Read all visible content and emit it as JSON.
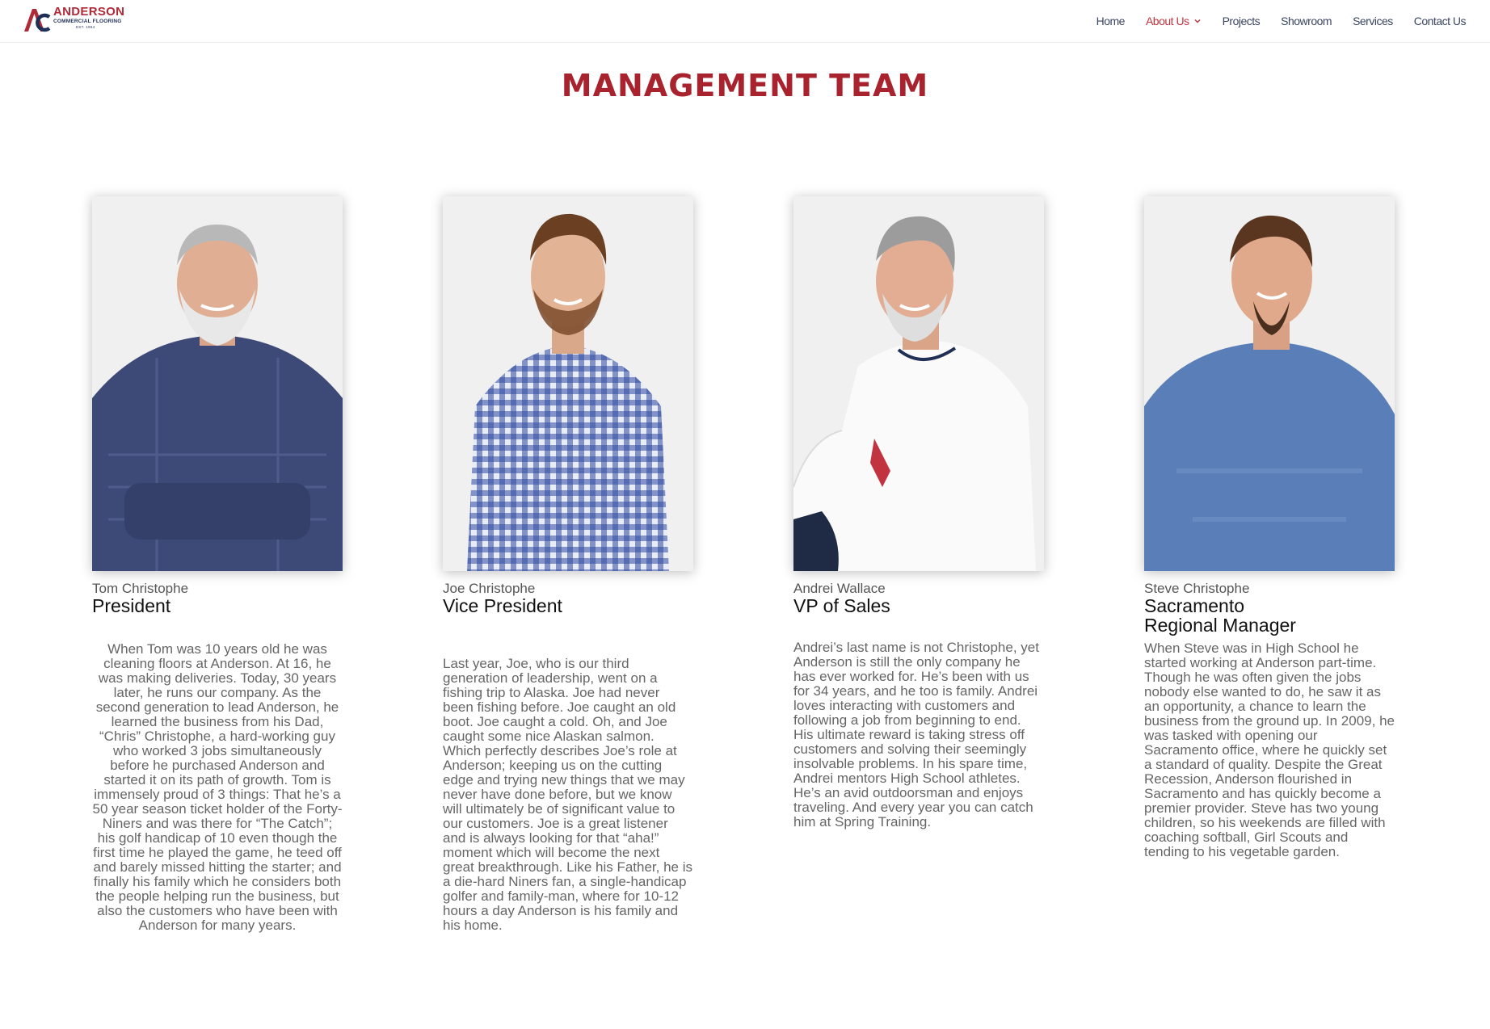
{
  "header": {
    "logo": {
      "name": "ANDERSON",
      "sub": "COMMERCIAL FLOORING",
      "est": "EST. 1954",
      "mark": "AC"
    },
    "nav": [
      {
        "label": "Home"
      },
      {
        "label": "About Us",
        "active": true,
        "has_dropdown": true
      },
      {
        "label": "Projects"
      },
      {
        "label": "Showroom"
      },
      {
        "label": "Services"
      },
      {
        "label": "Contact Us"
      }
    ]
  },
  "main": {
    "title": "MANAGEMENT TEAM",
    "team": [
      {
        "name": "Tom Christophe",
        "role": "President",
        "bio": "When Tom was 10 years old he was cleaning floors at Anderson.  At 16, he was making deliveries.  Today, 30 years later, he runs our company.  As the second generation to lead Anderson, he learned the business from his Dad, “Chris” Christophe, a hard-working guy who worked 3 jobs simultaneously before he purchased Anderson and started it on its path of growth.  Tom is immensely proud of 3 things: That he’s a 50 year season ticket holder of the Forty-Niners and was there for “The Catch”; his golf handicap of 10 even though the first time he played the game, he teed off and barely missed hitting the starter; and finally his family which he considers both the people helping run the business, but also the customers who have been with Anderson for many years."
      },
      {
        "name": "Joe Christophe",
        "role": "Vice President",
        "bio": "Last year, Joe, who is our third generation of leadership, went on a fishing trip to Alaska.  Joe had never been fishing before.  Joe caught an old boot.  Joe caught a cold.  Oh, and Joe caught some nice Alaskan salmon.  Which perfectly describes Joe’s role at Anderson; keeping us on the cutting edge and trying new things that we may never have done before, but we know will ultimately be of significant value to our customers.  Joe is a great listener and is always looking for that “aha!” moment which will become the next great breakthrough.  Like his Father, he is a die-hard Niners fan, a single-handicap golfer and family-man, where for 10-12 hours a day Anderson is his family and his home."
      },
      {
        "name": "Andrei Wallace",
        "role": "VP of Sales",
        "bio": "Andrei’s last name is not Christophe, yet Anderson is still the only company he has ever worked for.  He’s been with us for 34 years, and he too is family.  Andrei loves interacting with customers and following a job from beginning to end.  His ultimate reward is taking stress off customers and solving their seemingly insolvable problems.  In his spare time, Andrei mentors High School athletes.  He’s an avid outdoorsman and enjoys traveling. And every year you can catch him at Spring Training."
      },
      {
        "name": "Steve Christophe",
        "role_line1": "Sacramento",
        "role_line2": "Regional Manager",
        "bio": "When Steve was in High School he started working at Anderson part-time. Though he was often given the jobs nobody else wanted to do, he saw it as an opportunity, a chance to learn the business from the ground up.  In 2009, he was tasked with opening our Sacramento office, where he quickly set a standard of quality.  Despite the Great Recession, Anderson flourished in Sacramento and has quickly become a premier provider.   Steve has two young children, so his weekends are filled with coaching softball, Girl Scouts and tending to his vegetable garden."
      }
    ]
  },
  "colors": {
    "brand_red": "#a8232e",
    "nav_active": "#c0333f",
    "navy": "#1f2f55"
  }
}
